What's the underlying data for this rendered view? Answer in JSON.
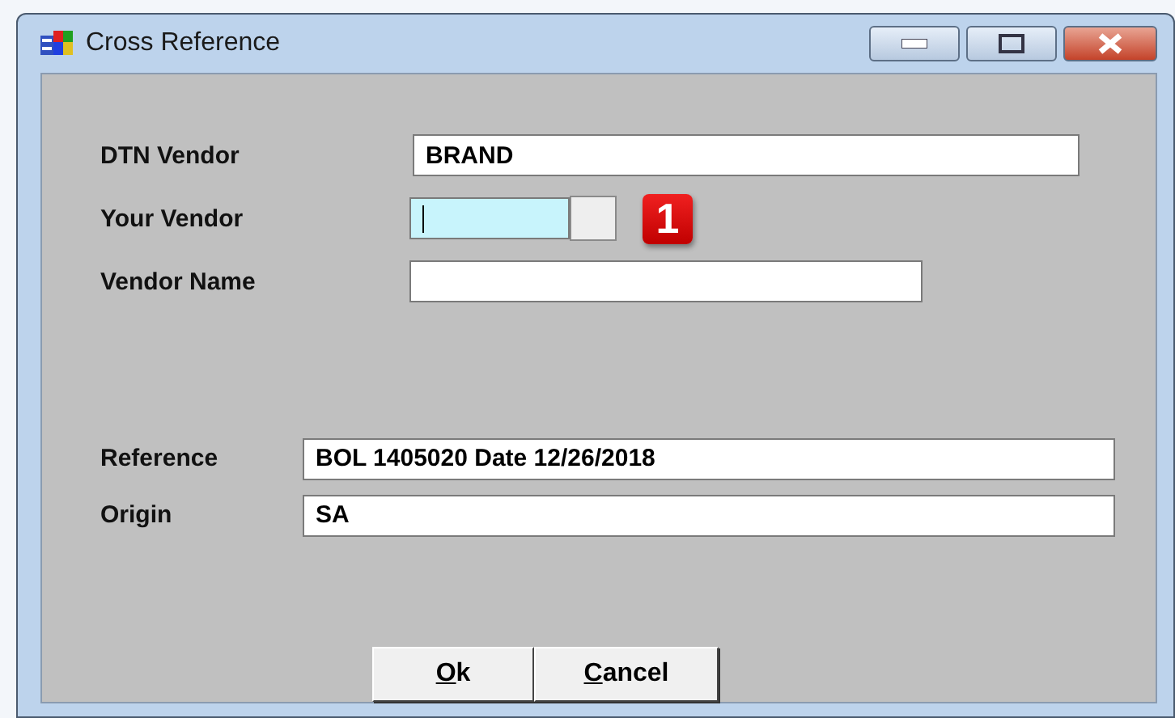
{
  "window": {
    "title": "Cross Reference"
  },
  "upper_fields": [
    {
      "label": "DTN Vendor",
      "value": "BRAND",
      "focused": false
    },
    {
      "label": "Your Vendor",
      "focused": true,
      "badge": "1"
    },
    {
      "label": "Vendor Name",
      "focused": false
    }
  ],
  "lower_fields": [
    {
      "label": "Reference",
      "value": "BOL 1405020 Date 12/26/2018"
    },
    {
      "label": "Origin",
      "value": "SA"
    }
  ],
  "buttons": [
    {
      "label": "Ok"
    },
    {
      "label": "Cancel"
    }
  ]
}
